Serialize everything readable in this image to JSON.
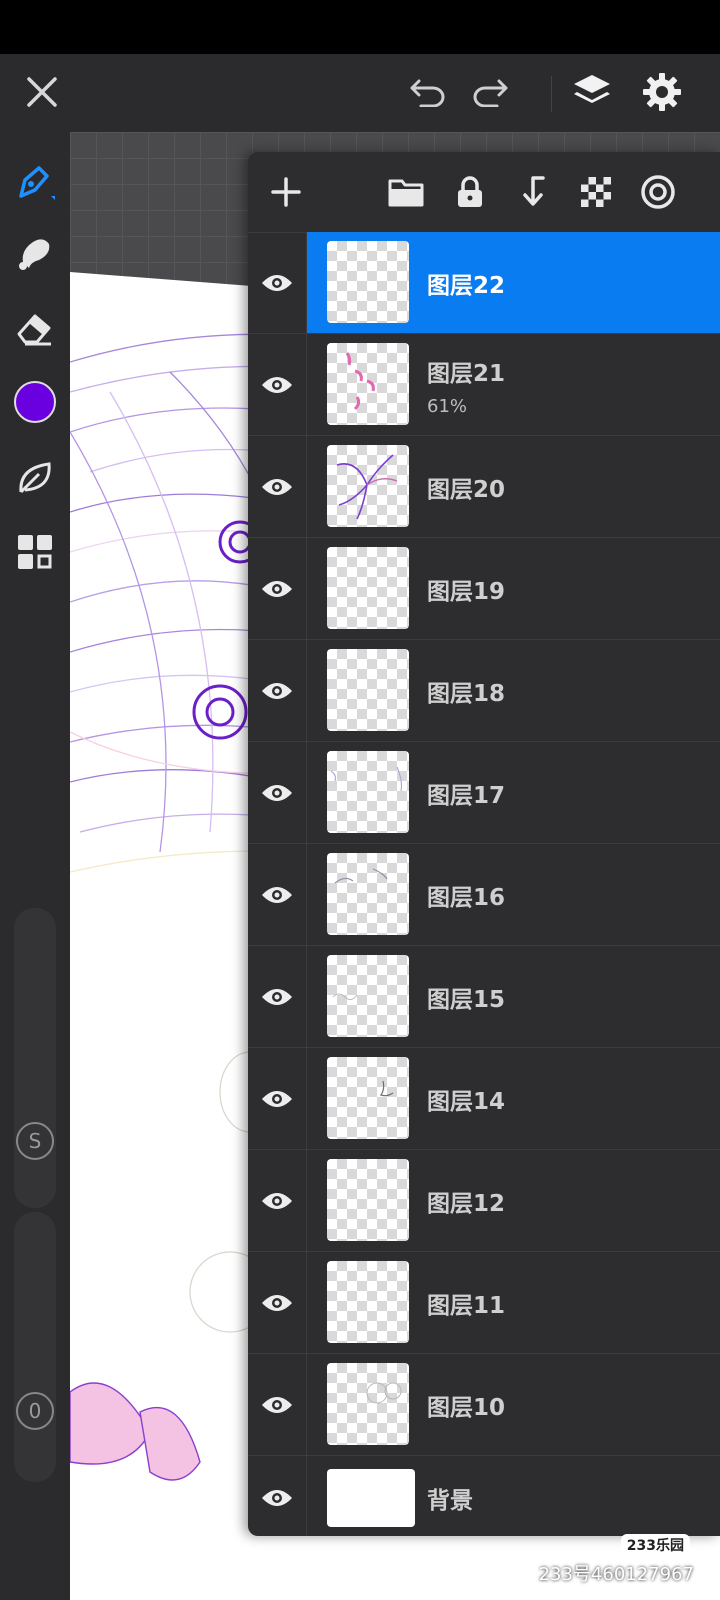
{
  "topbar": {
    "icons": [
      "close-icon",
      "undo-icon",
      "redo-icon",
      "layers-icon",
      "settings-icon"
    ]
  },
  "leftbar": {
    "tools": [
      "pen-tool-icon",
      "smudge-tool-icon",
      "eraser-tool-icon",
      "color-swatch",
      "leaf-shape-icon",
      "grid-apps-icon"
    ],
    "current_color": "#6a00e0",
    "size_badge": "S",
    "opacity_badge": "0"
  },
  "layers_panel": {
    "toolbar_icons": [
      "add-layer-icon",
      "folder-icon",
      "lock-icon",
      "merge-down-icon",
      "transparency-icon",
      "target-icon"
    ],
    "layers": [
      {
        "name": "图层22",
        "active": true
      },
      {
        "name": "图层21",
        "opacity": "61%"
      },
      {
        "name": "图层20"
      },
      {
        "name": "图层19"
      },
      {
        "name": "图层18"
      },
      {
        "name": "图层17"
      },
      {
        "name": "图层16"
      },
      {
        "name": "图层15"
      },
      {
        "name": "图层14"
      },
      {
        "name": "图层12"
      },
      {
        "name": "图层11"
      },
      {
        "name": "图层10"
      }
    ],
    "background_layer": "背景"
  },
  "watermark": {
    "logo": "233乐园",
    "text": "233号460127967"
  },
  "colors": {
    "accent": "#0a7cf2",
    "panel": "#2d2d30",
    "stroke_purple": "#7b2fd6"
  }
}
